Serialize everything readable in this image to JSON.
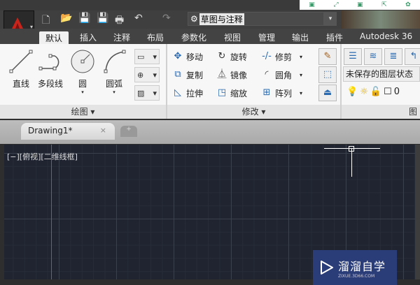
{
  "quick_access": {
    "workspace": "草图与注释",
    "icons": [
      "new-icon",
      "open-icon",
      "save-icon",
      "save-as-icon",
      "print-icon",
      "undo-icon",
      "redo-icon"
    ]
  },
  "tabs": [
    "默认",
    "插入",
    "注释",
    "布局",
    "参数化",
    "视图",
    "管理",
    "输出",
    "插件",
    "Autodesk 36"
  ],
  "draw_panel": {
    "title": "绘图 ▾",
    "tools": [
      "直线",
      "多段线",
      "圆",
      "圆弧"
    ]
  },
  "modify_panel": {
    "title": "修改 ▾",
    "tools": [
      "移动",
      "旋转",
      "修剪",
      "复制",
      "镜像",
      "圆角",
      "拉伸",
      "缩放",
      "阵列"
    ]
  },
  "layer_panel": {
    "title": "图",
    "layer_state": "未保存的图层状态",
    "layer_value": "0"
  },
  "document_tab": {
    "name": "Drawing1*",
    "close": "×",
    "new": "+"
  },
  "viewport_label": "[−][俯视][二维线框]",
  "watermark": {
    "text": "溜溜自学",
    "url": "ZIXUE.3D66.COM"
  },
  "colors": {
    "accent": "#c8241c",
    "canvas": "#1f2430",
    "y_axis": "#2f8a3a"
  }
}
